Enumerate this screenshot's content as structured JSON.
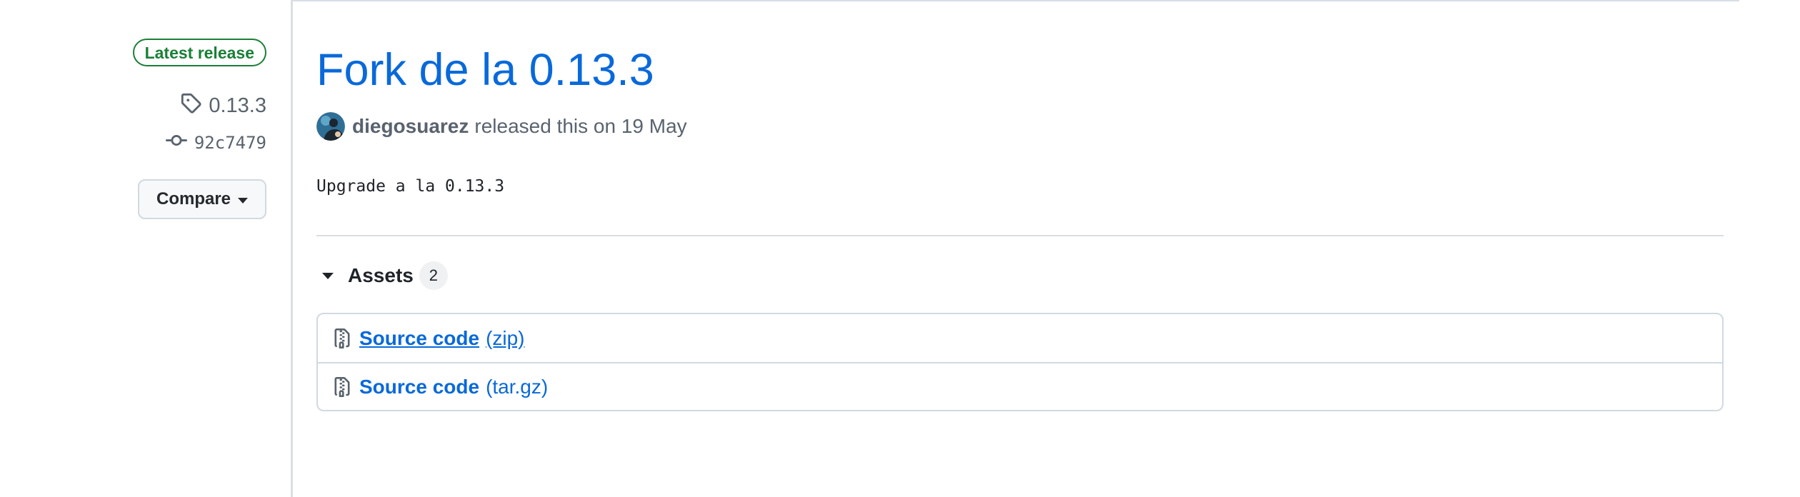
{
  "sidebar": {
    "latest_badge": "Latest release",
    "tag": "0.13.3",
    "commit": "92c7479",
    "compare_label": "Compare"
  },
  "release": {
    "title": "Fork de la 0.13.3",
    "author": "diegosuarez",
    "released_text": "released this on 19 May",
    "body": "Upgrade a la 0.13.3"
  },
  "assets": {
    "label": "Assets",
    "count": "2",
    "items": [
      {
        "name": "Source code",
        "ext": "(zip)"
      },
      {
        "name": "Source code",
        "ext": "(tar.gz)"
      }
    ]
  },
  "icons": {
    "tag": "tag-icon",
    "commit": "git-commit-icon",
    "caret": "triangle-down-icon",
    "file_zip": "file-zip-icon"
  },
  "colors": {
    "link": "#0969da",
    "success": "#1a7f37",
    "muted": "#59636e",
    "border": "#d1d9e0"
  }
}
